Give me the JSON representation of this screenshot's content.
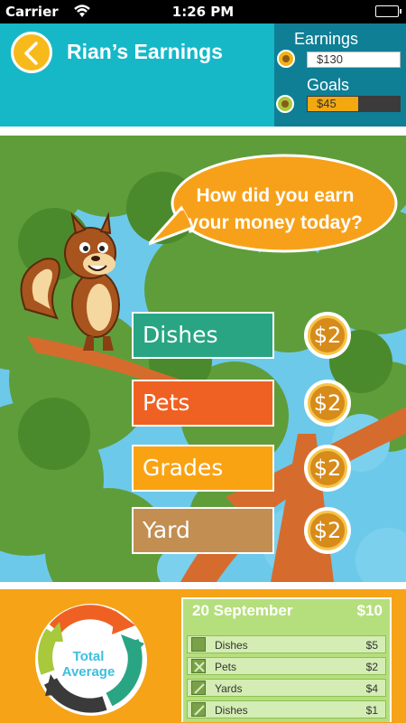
{
  "status": {
    "carrier": "Carrier",
    "time": "1:26 PM"
  },
  "header": {
    "title": "Rian’s Earnings",
    "earnings_label": "Earnings",
    "earnings_value": "$130",
    "goals_label": "Goals",
    "goals_value": "$45",
    "goals_progress": 0.55
  },
  "prompt": {
    "line1": "How did you earn",
    "line2": "your money today?"
  },
  "chores": [
    {
      "label": "Dishes",
      "amount": "$2",
      "color": "#2aa583"
    },
    {
      "label": "Pets",
      "amount": "$2",
      "color": "#ef6122"
    },
    {
      "label": "Grades",
      "amount": "$2",
      "color": "#f9a313"
    },
    {
      "label": "Yard",
      "amount": "$2",
      "color": "#c28e52"
    }
  ],
  "summary": {
    "cycle_line1": "Total",
    "cycle_line2": "Average",
    "date": "20 September",
    "total": "$10",
    "rows": [
      {
        "name": "Dishes",
        "amount": "$5",
        "mark": "none"
      },
      {
        "name": "Pets",
        "amount": "$2",
        "mark": "cross"
      },
      {
        "name": "Yards",
        "amount": "$4",
        "mark": "check"
      },
      {
        "name": "Dishes",
        "amount": "$1",
        "mark": "check"
      }
    ]
  },
  "icons": {
    "back": "chevron-left-icon",
    "wifi": "wifi-icon",
    "battery": "battery-icon",
    "coin": "coin-icon"
  }
}
